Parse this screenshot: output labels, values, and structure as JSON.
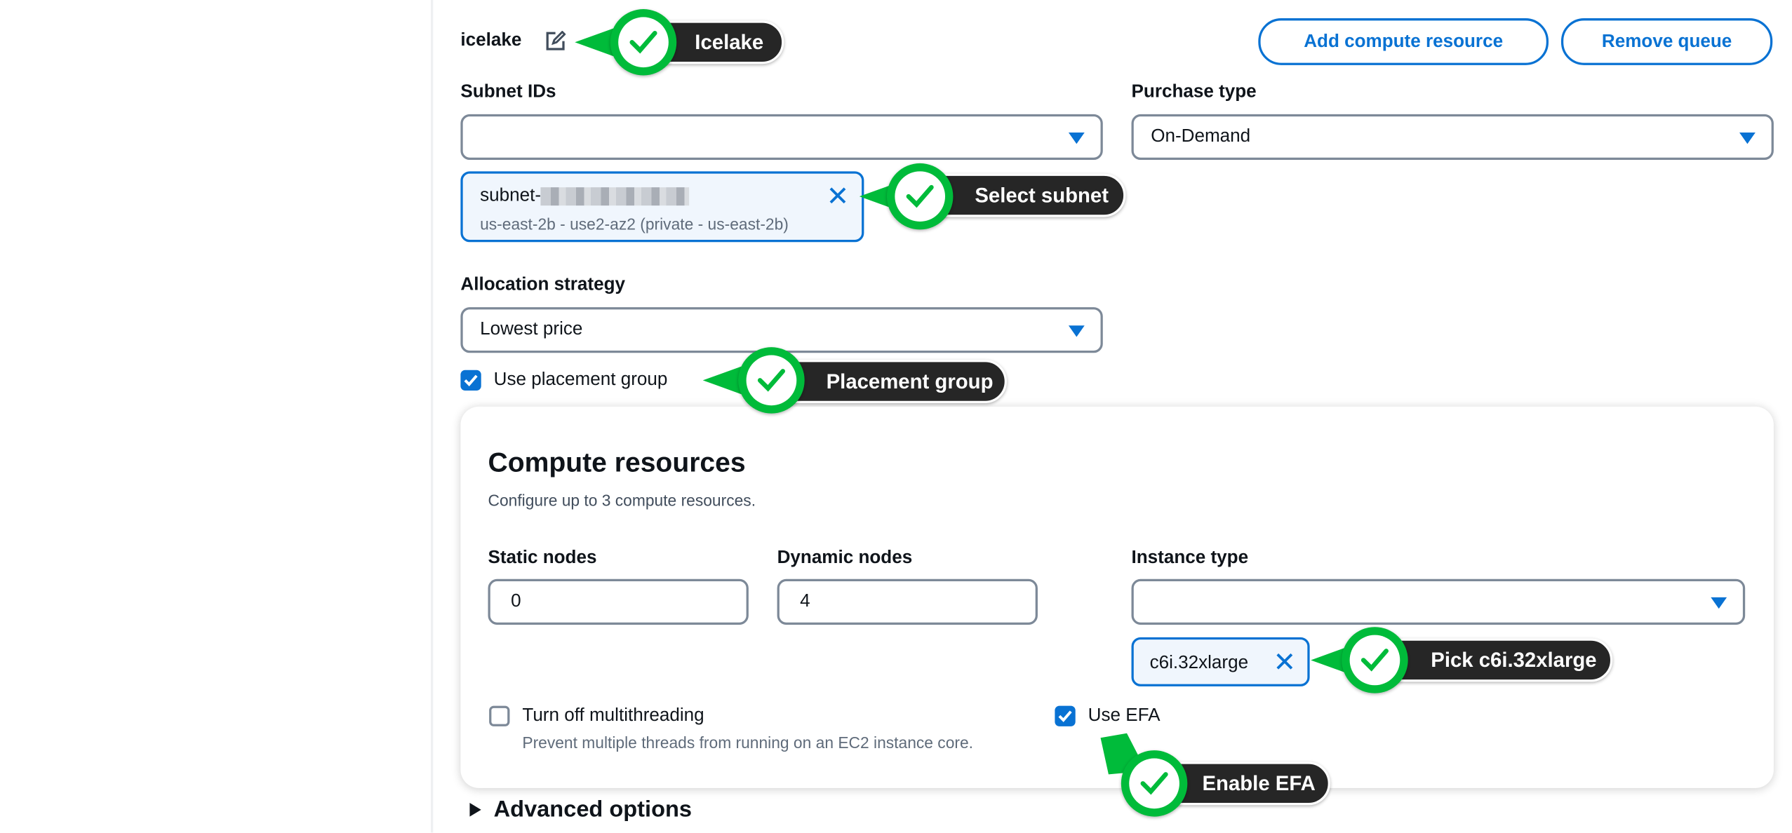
{
  "queue": {
    "name": "icelake",
    "edit_icon": "edit-icon"
  },
  "buttons": {
    "add_compute_resource": "Add compute resource",
    "remove_queue": "Remove queue"
  },
  "subnet": {
    "label": "Subnet IDs",
    "value": "",
    "token_prefix": "subnet-",
    "token_detail": "us-east-2b - use2-az2 (private - us-east-2b)"
  },
  "purchase_type": {
    "label": "Purchase type",
    "value": "On-Demand"
  },
  "allocation_strategy": {
    "label": "Allocation strategy",
    "value": "Lowest price"
  },
  "placement_group": {
    "label": "Use placement group",
    "checked": true
  },
  "compute_resources": {
    "title": "Compute resources",
    "description": "Configure up to 3 compute resources.",
    "static_nodes": {
      "label": "Static nodes",
      "value": "0"
    },
    "dynamic_nodes": {
      "label": "Dynamic nodes",
      "value": "4"
    },
    "instance_type": {
      "label": "Instance type",
      "value": "",
      "token": "c6i.32xlarge"
    },
    "multithreading": {
      "label": "Turn off multithreading",
      "description": "Prevent multiple threads from running on an EC2 instance core.",
      "checked": false
    },
    "efa": {
      "label": "Use EFA",
      "checked": true
    }
  },
  "advanced_options": {
    "label": "Advanced options"
  },
  "callouts": {
    "icelake": "Icelake",
    "subnet": "Select subnet",
    "placement": "Placement group",
    "instance": "Pick c6i.32xlarge",
    "efa": "Enable EFA"
  },
  "colors": {
    "accent": "#0972d3",
    "callout_green": "#00bb3a",
    "callout_dark": "#262626"
  }
}
